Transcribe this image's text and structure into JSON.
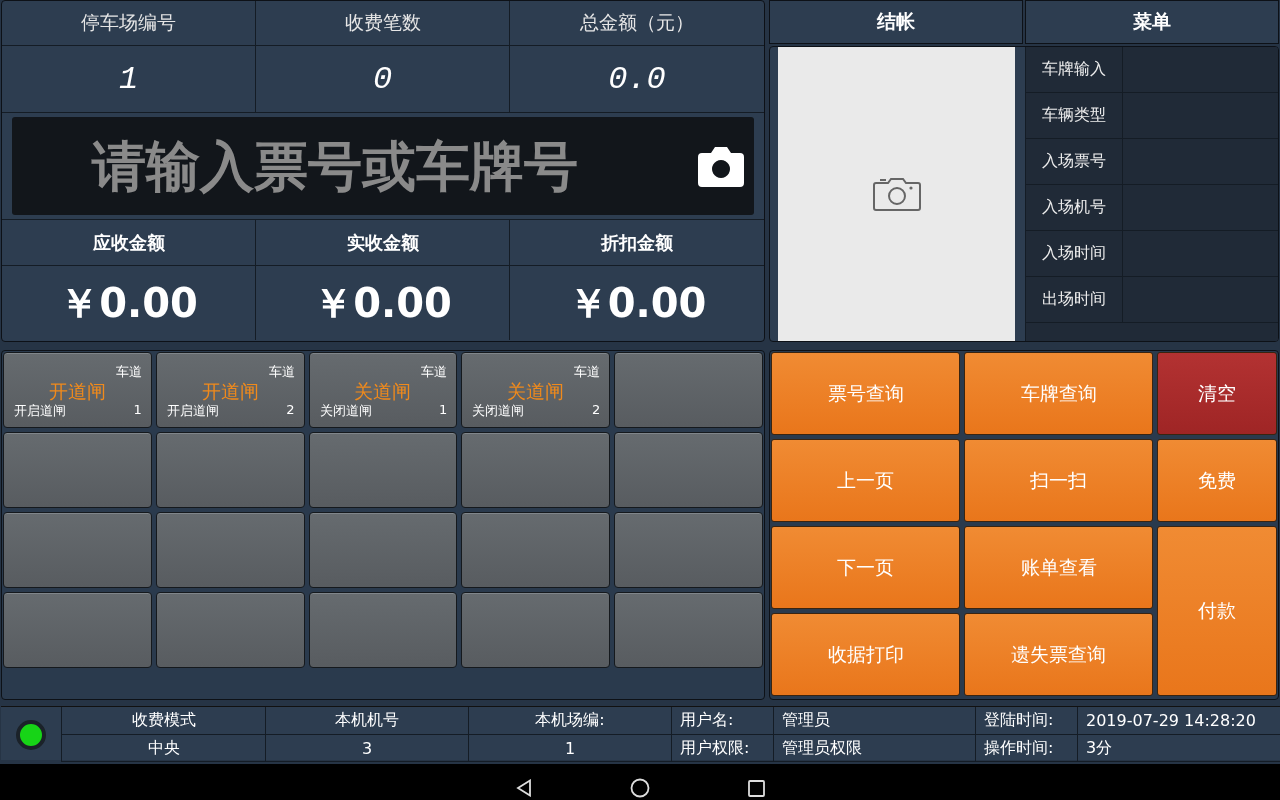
{
  "summary": {
    "columns": [
      {
        "label": "停车场编号",
        "value": "1"
      },
      {
        "label": "收费笔数",
        "value": "0"
      },
      {
        "label": "总金额（元）",
        "value": "0.0"
      }
    ]
  },
  "ticket_input": {
    "placeholder": "请输入票号或车牌号"
  },
  "amounts": [
    {
      "label": "应收金额",
      "value": "￥0.00"
    },
    {
      "label": "实收金额",
      "value": "￥0.00"
    },
    {
      "label": "折扣金额",
      "value": "￥0.00"
    }
  ],
  "gate_buttons": [
    {
      "lane_label": "车道",
      "action": "开道闸",
      "description": "开启道闸",
      "lane": "1"
    },
    {
      "lane_label": "车道",
      "action": "开道闸",
      "description": "开启道闸",
      "lane": "2"
    },
    {
      "lane_label": "车道",
      "action": "关道闸",
      "description": "关闭道闸",
      "lane": "1"
    },
    {
      "lane_label": "车道",
      "action": "关道闸",
      "description": "关闭道闸",
      "lane": "2"
    }
  ],
  "tabs": [
    {
      "label": "结帐"
    },
    {
      "label": "菜单"
    }
  ],
  "vehicle_info": {
    "fields": [
      {
        "label": "车牌输入"
      },
      {
        "label": "车辆类型"
      },
      {
        "label": "入场票号"
      },
      {
        "label": "入场机号"
      },
      {
        "label": "入场时间"
      },
      {
        "label": "出场时间"
      }
    ]
  },
  "action_buttons": [
    {
      "label": "票号查询",
      "kind": "orange"
    },
    {
      "label": "车牌查询",
      "kind": "orange"
    },
    {
      "label": "清空",
      "kind": "red"
    },
    {
      "label": "上一页",
      "kind": "orange"
    },
    {
      "label": "扫一扫",
      "kind": "orange"
    },
    {
      "label": "免费",
      "kind": "orange"
    },
    {
      "label": "下一页",
      "kind": "orange"
    },
    {
      "label": "账单查看",
      "kind": "orange"
    },
    {
      "label": "付款",
      "kind": "orange"
    },
    {
      "label": "收据打印",
      "kind": "orange"
    },
    {
      "label": "遗失票查询",
      "kind": "orange"
    }
  ],
  "status_bar": {
    "online": true,
    "columns": [
      {
        "label": "收费模式",
        "value": "中央"
      },
      {
        "label": "本机机号",
        "value": "3"
      },
      {
        "label": "本机场编:",
        "value": "1"
      }
    ],
    "pairs": [
      {
        "label": "用户名:",
        "value": "管理员"
      },
      {
        "label": "登陆时间:",
        "value": "2019-07-29 14:28:20"
      },
      {
        "label": "用户权限:",
        "value": "管理员权限"
      },
      {
        "label": "操作时间:",
        "value": "3分"
      }
    ]
  }
}
